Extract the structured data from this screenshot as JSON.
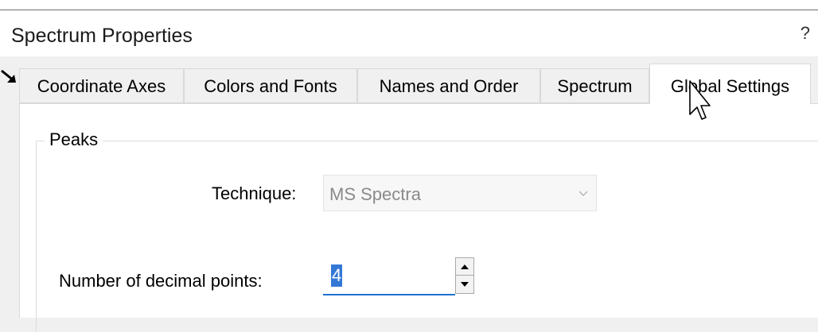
{
  "dialog": {
    "title": "Spectrum Properties",
    "help_label": "?"
  },
  "tabs": [
    {
      "label": "Coordinate Axes",
      "active": false
    },
    {
      "label": "Colors and Fonts",
      "active": false
    },
    {
      "label": "Names and Order",
      "active": false
    },
    {
      "label": "Spectrum",
      "active": false
    },
    {
      "label": "Global Settings",
      "active": true
    }
  ],
  "peaks": {
    "group_label": "Peaks",
    "technique_label": "Technique:",
    "technique_value": "MS Spectra",
    "decimal_label": "Number of decimal points:",
    "decimal_value": "4"
  },
  "colors": {
    "accent": "#3478d6",
    "focus_underline": "#1e6fcf"
  },
  "icons": [
    "pointer-arrow-icon",
    "chevron-down-icon",
    "spin-up-icon",
    "spin-down-icon",
    "mouse-cursor-icon"
  ]
}
